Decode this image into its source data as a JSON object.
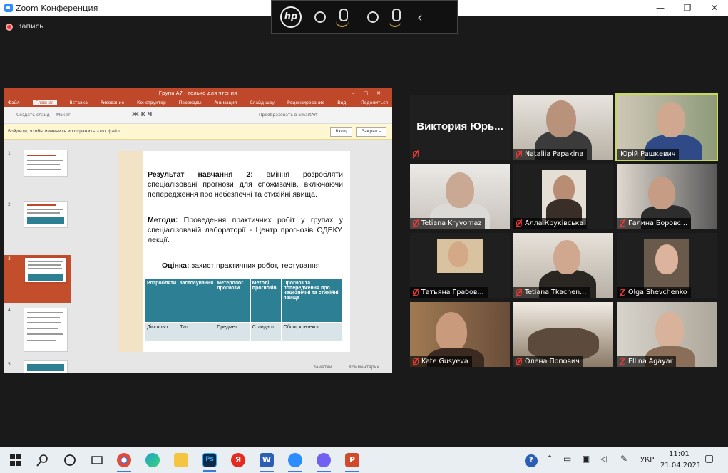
{
  "window": {
    "title": "Zoom Конференция",
    "recording_label": "Запись"
  },
  "hp_toolbar": {
    "logo": "hp"
  },
  "ppt": {
    "title": "Група А7 - только для чтения",
    "menu": [
      "Файл",
      "Главная",
      "Вставка",
      "Рисование",
      "Конструктор",
      "Переходы",
      "Анимация",
      "Слайд-шоу",
      "Рецензирование",
      "Вид"
    ],
    "share": "Поделиться",
    "ribbon_paste": "Создать слайд",
    "ribbon_layout": "Макет",
    "ribbon_smartart": "Преобразовать в SmartArt",
    "message": "Войдите, чтобы изменить и сохранить этот файл.",
    "login_btn": "Вход",
    "close_btn": "Закрыть",
    "slide_numbers": [
      "1",
      "2",
      "3",
      "4",
      "5"
    ],
    "notes": "Заметки",
    "comments": "Комментарии",
    "slide": {
      "p1_bold": "Результат навчання 2:",
      "p1_rest": " вміння розробляти спеціалізовані прогнози для споживачів, включаючи попередження про небезпечні та стихійні явища.",
      "p2_bold": "Методи:",
      "p2_rest": " Проведення практичних робіт у групах у спеціалізованій лабораторії - Центр прогнозів ОДЕКУ, лекції.",
      "p3_bold": "Оцінка:",
      "p3_rest": "  захист практичних робот, тестування",
      "table_headers": [
        "Розробляти",
        "застосування",
        "Метеролог. прогнози",
        "Методі прогнозів",
        "Прогноз та попередження про небезпечні та стихійні явища"
      ],
      "table_row": [
        "Дієслово",
        "Тип",
        "Предмет",
        "Стандарт",
        "Обсяг, контекст"
      ]
    }
  },
  "participants": [
    {
      "name": "Виктория Юрь...",
      "big": true
    },
    {
      "name": "Nataliia Papakina"
    },
    {
      "name": "Юрій Рашкевич",
      "active": true
    },
    {
      "name": "Tetiana Kryvomaz"
    },
    {
      "name": "Алла Круківська"
    },
    {
      "name": "Галина Боровс..."
    },
    {
      "name": "Татьяна Грабов..."
    },
    {
      "name": "Tetiana Tkachen..."
    },
    {
      "name": "Olga Shevchenko"
    },
    {
      "name": "Kate Gusyeva"
    },
    {
      "name": "Олена Попович"
    },
    {
      "name": "Ellina Agayar"
    }
  ],
  "taskbar": {
    "lang": "УКР",
    "time": "11:01",
    "date": "21.04.2021"
  },
  "colors": {
    "ppt_accent": "#c0482a",
    "table_teal": "#2d7f94",
    "active_border": "#c7d95a"
  }
}
